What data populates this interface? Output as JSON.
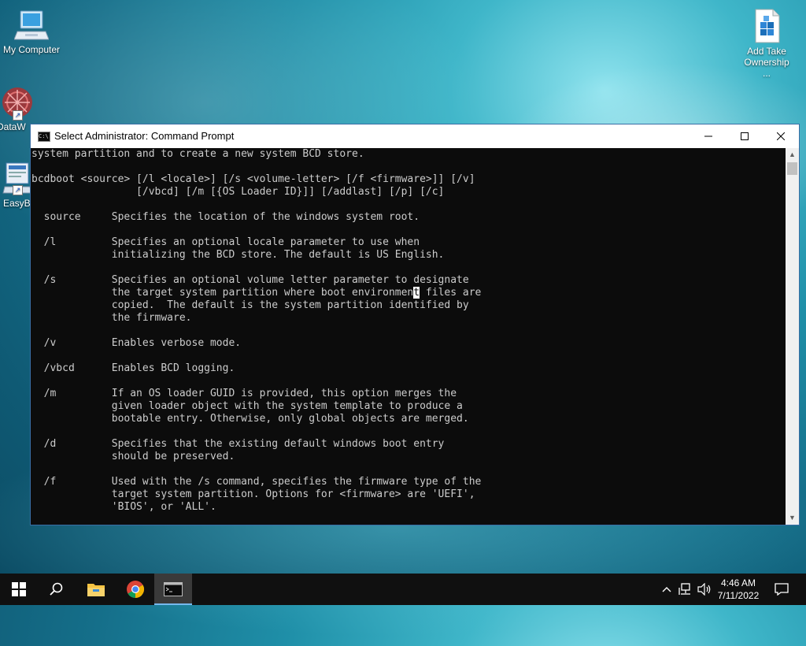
{
  "desktop": {
    "icons": [
      {
        "label": "My Computer"
      },
      {
        "label": "DataW"
      },
      {
        "label": "EasyB"
      },
      {
        "label": "Add Take Ownership ..."
      }
    ]
  },
  "window": {
    "title": "Select Administrator: Command Prompt",
    "icon_text": "C:\\",
    "console_before_cursor": "system partition and to create a new system BCD store.\n\nbcdboot <source> [/l <locale>] [/s <volume-letter> [/f <firmware>]] [/v]\n                 [/vbcd] [/m [{OS Loader ID}]] [/addlast] [/p] [/c]\n\n  source     Specifies the location of the windows system root.\n\n  /l         Specifies an optional locale parameter to use when\n             initializing the BCD store. The default is US English.\n\n  /s         Specifies an optional volume letter parameter to designate\n             the target system partition where boot environmen",
    "console_cursor_char": "t",
    "console_after_cursor": " files are\n             copied.  The default is the system partition identified by\n             the firmware.\n\n  /v         Enables verbose mode.\n\n  /vbcd      Enables BCD logging.\n\n  /m         If an OS loader GUID is provided, this option merges the\n             given loader object with the system template to produce a\n             bootable entry. Otherwise, only global objects are merged.\n\n  /d         Specifies that the existing default windows boot entry\n             should be preserved.\n\n  /f         Used with the /s command, specifies the firmware type of the\n             target system partition. Options for <firmware> are 'UEFI',\n             'BIOS', or 'ALL'."
  },
  "taskbar": {
    "apps": [
      "start-icon",
      "search-icon",
      "file-explorer-icon",
      "chrome-icon",
      "command-prompt-icon"
    ],
    "time": "4:46 AM",
    "date": "7/11/2022"
  },
  "colors": {
    "console_bg": "#0c0c0c",
    "console_text": "#cccccc",
    "taskbar_bg": "#101010",
    "accent": "#76b9ed"
  }
}
